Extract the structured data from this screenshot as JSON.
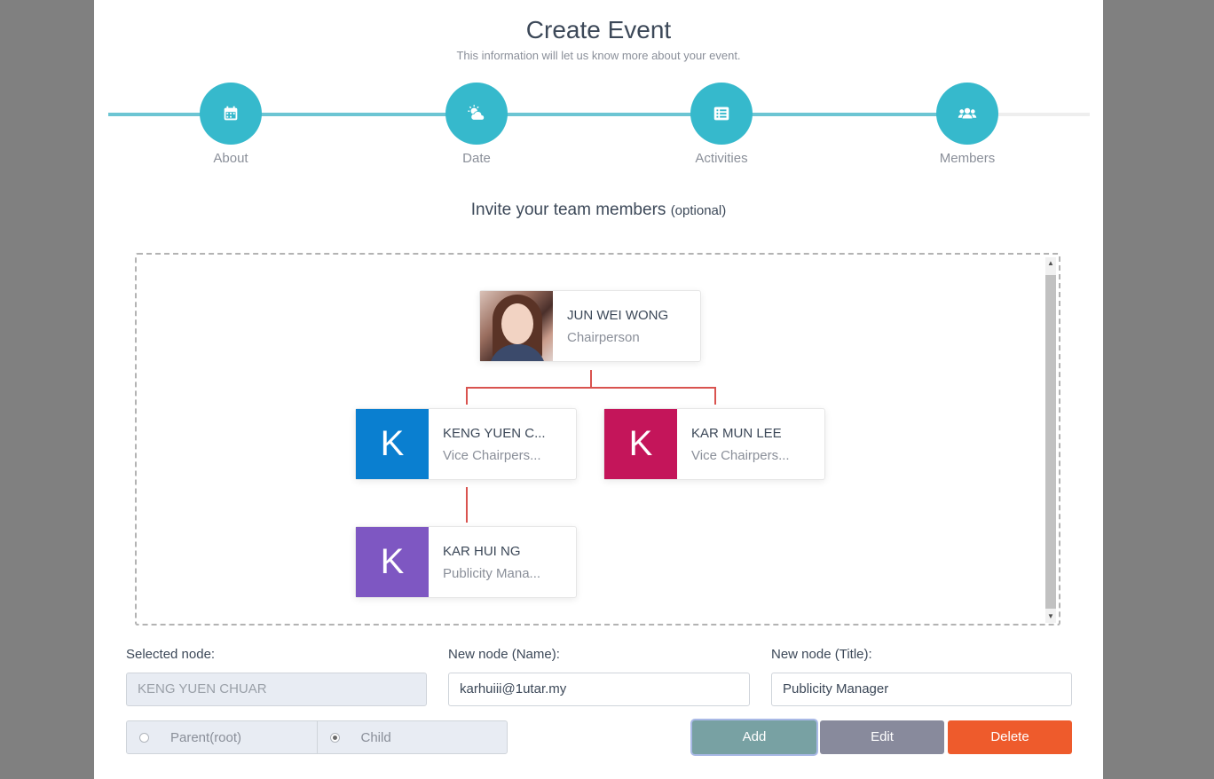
{
  "header": {
    "title": "Create Event",
    "subtitle": "This information will let us know more about your event."
  },
  "wizard": {
    "progress_percent": 88,
    "steps": [
      {
        "label": "About",
        "icon": "calendar-icon"
      },
      {
        "label": "Date",
        "icon": "weather-icon"
      },
      {
        "label": "Activities",
        "icon": "list-icon"
      },
      {
        "label": "Members",
        "icon": "users-icon"
      }
    ],
    "accent": "#36b9cc"
  },
  "section": {
    "heading": "Invite your team members",
    "heading_note": "(optional)"
  },
  "org_chart": {
    "root": {
      "name": "JUN WEI WONG",
      "title": "Chairperson",
      "avatar": "photo"
    },
    "children": [
      {
        "name": "KENG YUEN C...",
        "title": "Vice Chairpers...",
        "initial": "K",
        "color": "#0a7fd0"
      },
      {
        "name": "KAR MUN LEE",
        "title": "Vice Chairpers...",
        "initial": "K",
        "color": "#c4155a"
      }
    ],
    "grandchild": {
      "name": "KAR HUI NG",
      "title": "Publicity Mana...",
      "initial": "K",
      "color": "#7e57c2"
    },
    "connector_color": "#d9534f"
  },
  "form": {
    "selected_label": "Selected node:",
    "selected_value": "KENG YUEN CHUAR",
    "name_label": "New node (Name):",
    "name_value": "karhuiii@1utar.my",
    "title_label": "New node (Title):",
    "title_value": "Publicity Manager",
    "radio_parent": "Parent(root)",
    "radio_child": "Child",
    "selected_radio": "Child"
  },
  "buttons": {
    "add": "Add",
    "edit": "Edit",
    "delete": "Delete",
    "add_color": "#78a1a3",
    "edit_color": "#888a9c",
    "delete_color": "#ee5b2c"
  }
}
